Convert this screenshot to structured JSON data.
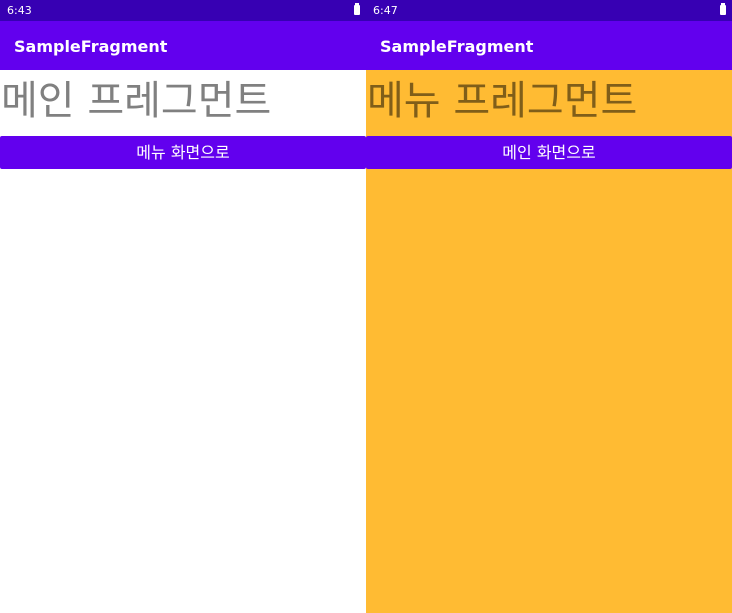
{
  "colors": {
    "status_bar": "#3700b3",
    "app_bar": "#6200ee",
    "button": "#6200ee",
    "menu_background": "#ffbb33",
    "main_title_text": "#808080",
    "menu_title_text": "#805e19"
  },
  "left_screen": {
    "status_bar": {
      "time": "6:43",
      "battery_icon": "battery-full-icon"
    },
    "app_bar": {
      "title": "SampleFragment"
    },
    "fragment": {
      "title": "메인 프레그먼트",
      "button_label": "메뉴 화면으로"
    }
  },
  "right_screen": {
    "status_bar": {
      "time": "6:47",
      "battery_icon": "battery-full-icon"
    },
    "app_bar": {
      "title": "SampleFragment"
    },
    "fragment": {
      "title": "메뉴 프레그먼트",
      "button_label": "메인 화면으로"
    }
  }
}
